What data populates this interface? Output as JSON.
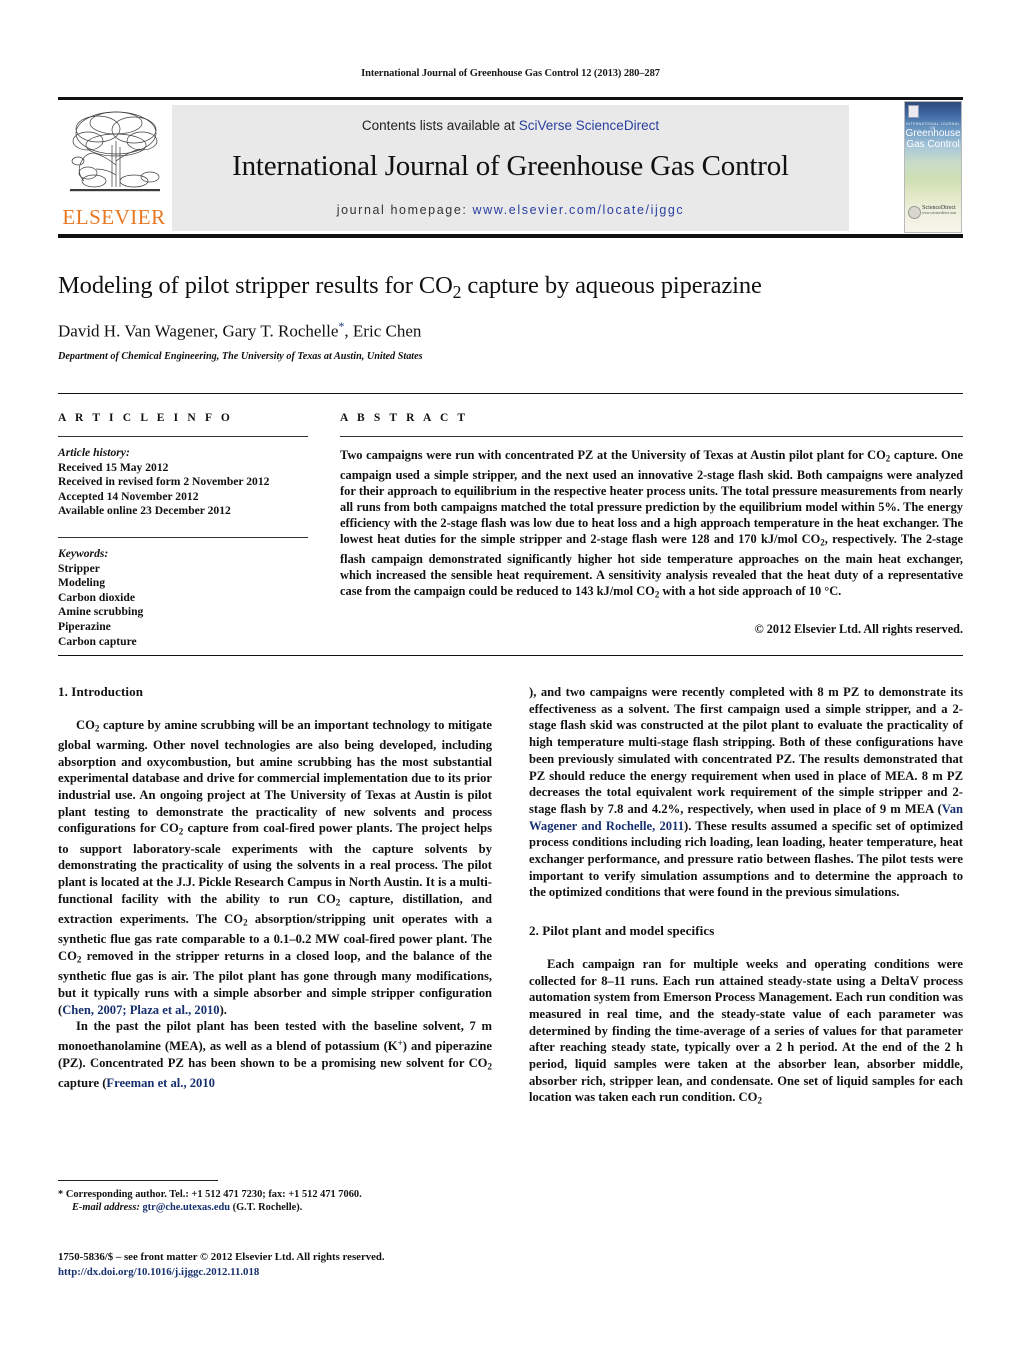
{
  "running_head": "International Journal of Greenhouse Gas Control 12 (2013) 280–287",
  "masthead": {
    "contents_prefix": "Contents lists available at ",
    "contents_link": "SciVerse ScienceDirect",
    "journal_title": "International Journal of Greenhouse Gas Control",
    "homepage_prefix": "journal homepage: ",
    "homepage_url": "www.elsevier.com/locate/ijggc",
    "publisher_wordmark": "ELSEVIER",
    "publisher_color": "#E87722",
    "link_color": "#2a3fa0",
    "band_color": "#e9e9e9"
  },
  "cover": {
    "kicker": "INTERNATIONAL JOURNAL OF",
    "name_line1": "Greenhouse",
    "name_line2": "Gas Control",
    "foot_big": "ScienceDirect",
    "foot_small": "www.sciencedirect.com"
  },
  "article": {
    "title_part1": "Modeling of pilot stripper results for CO",
    "title_sub": "2",
    "title_part2": " capture by aqueous piperazine",
    "authors": "David H. Van Wagener, Gary T. Rochelle",
    "author_star": "*",
    "authors_tail": ", Eric Chen",
    "affiliation": "Department of Chemical Engineering, The University of Texas at Austin, United States"
  },
  "info": {
    "heading": "A R T I C L E   I N F O",
    "history_label": "Article history:",
    "history": [
      "Received 15 May 2012",
      "Received in revised form 2 November 2012",
      "Accepted 14 November 2012",
      "Available online 23 December 2012"
    ],
    "keywords_label": "Keywords:",
    "keywords": [
      "Stripper",
      "Modeling",
      "Carbon dioxide",
      "Amine scrubbing",
      "Piperazine",
      "Carbon capture"
    ]
  },
  "abstract": {
    "heading": "A B S T R A C T",
    "p1": "Two campaigns were run with concentrated PZ at the University of Texas at Austin pilot plant for CO",
    "p1_sub": "2",
    "p2": " capture. One campaign used a simple stripper, and the next used an innovative 2-stage flash skid. Both campaigns were analyzed for their approach to equilibrium in the respective heater process units. The total pressure measurements from nearly all runs from both campaigns matched the total pressure prediction by the equilibrium model within 5%. The energy efficiency with the 2-stage flash was low due to heat loss and a high approach temperature in the heat exchanger. The lowest heat duties for the simple stripper and 2-stage flash were 128 and 170 kJ/mol CO",
    "p2_sub": "2",
    "p3": ", respectively. The 2-stage flash campaign demonstrated significantly higher hot side temperature approaches on the main heat exchanger, which increased the sensible heat requirement. A sensitivity analysis revealed that the heat duty of a representative case from the campaign could be reduced to 143 kJ/mol CO",
    "p3_sub": "2",
    "p4": " with a hot side approach of 10 °C.",
    "copyright": "© 2012 Elsevier Ltd. All rights reserved."
  },
  "sections": {
    "intro_heading": "1. Introduction",
    "intro_p1_a": "CO",
    "intro_p1_sub": "2",
    "intro_p1_b": " capture by amine scrubbing will be an important technology to mitigate global warming. Other novel technologies are also being developed, including absorption and oxycombustion, but amine scrubbing has the most substantial experimental database and drive for commercial implementation due to its prior industrial use. An ongoing project at The University of Texas at Austin is pilot plant testing to demonstrate the practicality of new solvents and process configurations for CO",
    "intro_p1_c": " capture from coal-fired power plants. The project helps to support laboratory-scale experiments with the capture solvents by demonstrating the practicality of using the solvents in a real process. The pilot plant is located at the J.J. Pickle Research Campus in North Austin. It is a multi-functional facility with the ability to run CO",
    "intro_p1_d": " capture, distillation, and extraction experiments. The CO",
    "intro_p1_e": " absorption/stripping unit operates with a synthetic flue gas rate comparable to a 0.1–0.2 MW coal-fired power plant. The CO",
    "intro_p1_f": " removed in the stripper returns in a closed loop, and the balance of the synthetic flue gas is air. The pilot plant has gone through many modifications, but it typically runs with a simple absorber and simple stripper configuration (",
    "intro_p1_ref1": "Chen, 2007; Plaza et al., 2010",
    "intro_p1_g": ").",
    "intro_p2_a": "In the past the pilot plant has been tested with the baseline solvent, 7 m monoethanolamine (MEA), as well as a blend of potassium (K",
    "intro_p2_sup": "+",
    "intro_p2_b": ") and piperazine (PZ). Concentrated PZ has been shown to be a promising new solvent for CO",
    "intro_p2_c": " capture (",
    "intro_p2_ref": "Freeman et al., 2010",
    "intro_p2_d": "), and two campaigns were recently completed with 8 m PZ to demonstrate its effectiveness as a solvent. The first campaign used a simple stripper, and a 2-stage flash skid was constructed at the pilot plant to evaluate the practicality of high temperature multi-stage flash stripping. Both of these configurations have been previously simulated with concentrated PZ. The results demonstrated that PZ should reduce the energy requirement when used in place of MEA. 8 m PZ decreases the total equivalent work requirement of the simple stripper and 2-stage flash by 7.8 and 4.2%, respectively, when used in place of 9 m MEA (",
    "intro_p2_ref2": "Van Wagener and Rochelle, 2011",
    "intro_p2_e": "). These results assumed a specific set of optimized process conditions including rich loading, lean loading, heater temperature, heat exchanger performance, and pressure ratio between flashes. The pilot tests were important to verify simulation assumptions and to determine the approach to the optimized conditions that were found in the previous simulations.",
    "pilot_heading": "2. Pilot plant and model specifics",
    "pilot_p1_a": "Each campaign ran for multiple weeks and operating conditions were collected for 8–11 runs. Each run attained steady-state using a DeltaV process automation system from Emerson Process Management. Each run condition was measured in real time, and the steady-state value of each parameter was determined by finding the time-average of a series of values for that parameter after reaching steady state, typically over a 2 h period. At the end of the 2 h period, liquid samples were taken at the absorber lean, absorber middle, absorber rich, stripper lean, and condensate. One set of liquid samples for each location was taken each run condition. CO",
    "pilot_p1_sub": "2"
  },
  "footnote": {
    "star": "*",
    "corresponding": "Corresponding author. Tel.: +1 512 471 7230; fax: +1 512 471 7060.",
    "email_label": "E-mail address:",
    "email": "gtr@che.utexas.edu",
    "email_tail": " (G.T. Rochelle)."
  },
  "imprint": {
    "line1": "1750-5836/$ – see front matter © 2012 Elsevier Ltd. All rights reserved.",
    "doi": "http://dx.doi.org/10.1016/j.ijggc.2012.11.018"
  }
}
